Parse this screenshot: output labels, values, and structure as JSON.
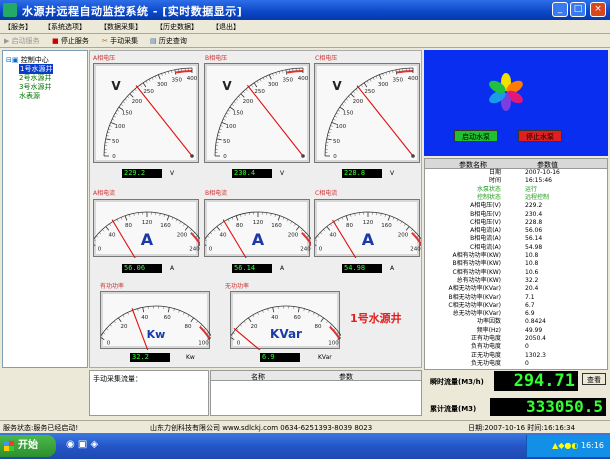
{
  "window": {
    "title": "水源井远程自动监控系统 - [实时数据显示]"
  },
  "menu": [
    "【服务】",
    "【系统选项】",
    "【数据采集】",
    "【历史数据】",
    "【退出】"
  ],
  "toolbar": {
    "start": "启动服务",
    "stop": "停止服务",
    "manual": "手动采集",
    "history": "历史查询"
  },
  "tree": {
    "root": "控制中心",
    "items": [
      "1号水源井",
      "2号水源井",
      "3号水源井",
      "水表源"
    ]
  },
  "voltage": [
    {
      "label": "A相电压",
      "digital": "229.2",
      "unit": "V",
      "value": 229.2
    },
    {
      "label": "B相电压",
      "digital": "230.4",
      "unit": "V",
      "value": 230.4
    },
    {
      "label": "C相电压",
      "digital": "228.8",
      "unit": "V",
      "value": 228.8
    }
  ],
  "voltage_scale": [
    "0",
    "50",
    "100",
    "150",
    "200",
    "250",
    "300",
    "350",
    "400"
  ],
  "current": [
    {
      "label": "A相电流",
      "digital": "56.06",
      "unit": "A",
      "value": 56.06
    },
    {
      "label": "B相电流",
      "digital": "56.14",
      "unit": "A",
      "value": 56.14
    },
    {
      "label": "C相电流",
      "digital": "54.98",
      "unit": "A",
      "value": 54.98
    }
  ],
  "current_scale": [
    "0",
    "40",
    "80",
    "120",
    "160",
    "200",
    "240"
  ],
  "power": [
    {
      "label": "有功功率",
      "digital": "32.2",
      "unit": "Kw",
      "symbol": "Kw",
      "value": 32.2
    },
    {
      "label": "无功功率",
      "digital": "6.9",
      "unit": "KVar",
      "symbol": "KVar",
      "value": 6.9
    }
  ],
  "power_scale": [
    "0",
    "20",
    "40",
    "60",
    "80",
    "100"
  ],
  "gauge_symbols": {
    "voltage": "V",
    "current": "A"
  },
  "well_name": "1号水源井",
  "buttons": {
    "start_pump": "启动水泵",
    "stop_pump": "停止水泵",
    "query": "查看"
  },
  "params": {
    "col_name": "参数名称",
    "col_value": "参数值",
    "rows": [
      [
        "日期",
        "2007-10-16"
      ],
      [
        "时间",
        "16:15:46"
      ],
      [
        "水泵状态",
        "运行"
      ],
      [
        "控制状态",
        "远程控制"
      ],
      [
        "A相电压(V)",
        "229.2"
      ],
      [
        "B相电压(V)",
        "230.4"
      ],
      [
        "C相电压(V)",
        "228.8"
      ],
      [
        "A相电流(A)",
        "56.06"
      ],
      [
        "B相电流(A)",
        "56.14"
      ],
      [
        "C相电流(A)",
        "54.98"
      ],
      [
        "A相有功功率(KW)",
        "10.8"
      ],
      [
        "B相有功功率(KW)",
        "10.8"
      ],
      [
        "C相有功功率(KW)",
        "10.6"
      ],
      [
        "总有功功率(KW)",
        "32.2"
      ],
      [
        "A相无功功率(KVar)",
        "20.4"
      ],
      [
        "B相无功功率(KVar)",
        "7.1"
      ],
      [
        "C相无功功率(KVar)",
        "6.7"
      ],
      [
        "总无功功率(KVar)",
        "6.9"
      ],
      [
        "功率因数",
        "0.8424"
      ],
      [
        "频率(Hz)",
        "49.99"
      ],
      [
        "正有功电度",
        "2050.4"
      ],
      [
        "负有功电度",
        "0"
      ],
      [
        "正无功电度",
        "1302.3"
      ],
      [
        "负无功电度",
        "0"
      ]
    ]
  },
  "manual_panel": {
    "label": "手动采集流量："
  },
  "list_headers": {
    "name": "名称",
    "param": "参数"
  },
  "flow": {
    "instant_label": "瞬时流量(M3/h)",
    "instant": "294.71",
    "total_label": "累计流量(M3)",
    "total": "333050.5"
  },
  "status": {
    "left": "服务状态:服务已经启动!",
    "center": "山东力创科技有限公司 www.sdlckj.com 0634-6251393-8039 8023",
    "right": "日期:2007-10-16 时间:16:16:34"
  },
  "taskbar": {
    "start": "开始",
    "clock": "16:16"
  }
}
